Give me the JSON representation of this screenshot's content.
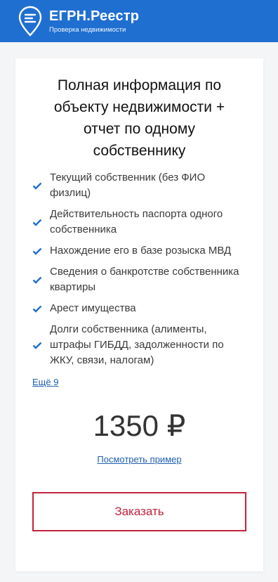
{
  "header": {
    "brand": "ЕГРН.Реестр",
    "tagline": "Проверка недвижимости"
  },
  "card": {
    "title": "Полная информация по объекту недвижимости + отчет по одному собственнику",
    "features": [
      "Текущий собственник (без ФИО физлиц)",
      "Действительность паспорта одного собственника",
      "Нахождение его в базе розыска МВД",
      "Сведения о банкротстве собственника квартиры",
      "Арест имущества",
      "Долги собственника (алименты, штрафы ГИБДД, задолженности по ЖКУ, связи, налогам)"
    ],
    "more_link": "Ещё 9",
    "price": "1350 ₽",
    "example_link": "Посмотреть пример",
    "order_button": "Заказать"
  },
  "colors": {
    "header_bg": "#1f6fd1",
    "accent_red": "#c3233c",
    "check_blue": "#1f6fd1",
    "link_blue": "#1f5fb2"
  },
  "icons": {
    "logo": "map-pin-menu-icon",
    "feature_check": "check-icon"
  }
}
